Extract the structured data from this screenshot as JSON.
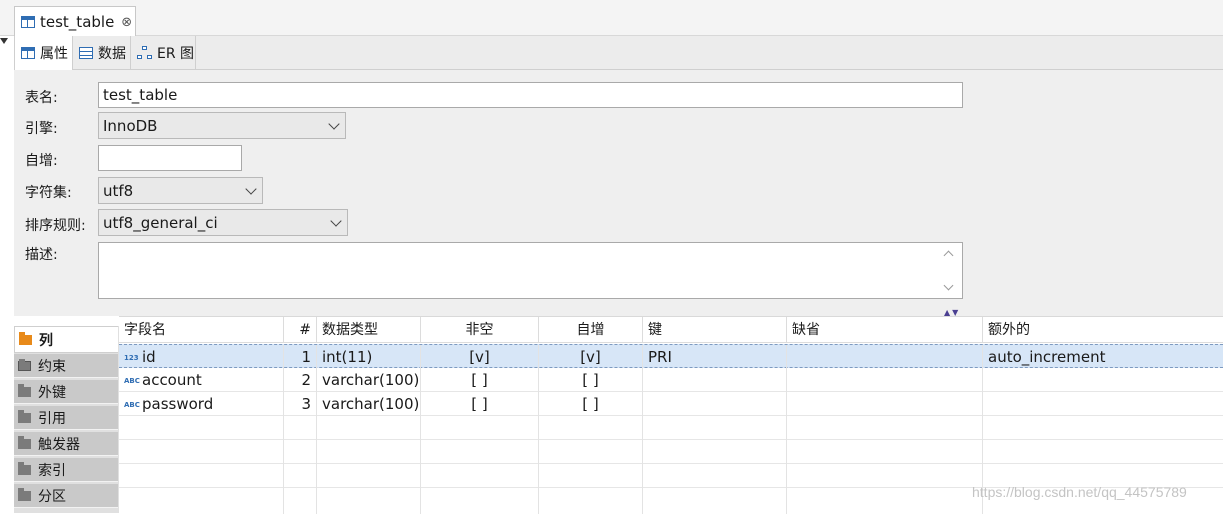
{
  "editor_tab": {
    "title": "test_table",
    "close": "⊗"
  },
  "subtabs": [
    {
      "label": "属性",
      "icon": "table-icon"
    },
    {
      "label": "数据",
      "icon": "data-grid-icon"
    },
    {
      "label": "ER 图",
      "icon": "er-diagram-icon"
    }
  ],
  "form": {
    "table_name_label": "表名:",
    "table_name_value": "test_table",
    "engine_label": "引擎:",
    "engine_value": "InnoDB",
    "auto_inc_label": "自增:",
    "auto_inc_value": "",
    "charset_label": "字符集:",
    "charset_value": "utf8",
    "collation_label": "排序规则:",
    "collation_value": "utf8_general_ci",
    "comment_label": "描述:",
    "comment_value": ""
  },
  "side_tabs": [
    "列",
    "约束",
    "外键",
    "引用",
    "触发器",
    "索引",
    "分区"
  ],
  "columns_table": {
    "headers": [
      "字段名",
      "#",
      "数据类型",
      "非空",
      "自增",
      "键",
      "缺省",
      "额外的"
    ],
    "rows": [
      {
        "type_icon": "123",
        "name": "id",
        "num": "1",
        "datatype": "int(11)",
        "not_null": "[v]",
        "auto_inc": "[v]",
        "key": "PRI",
        "default": "",
        "extra": "auto_increment"
      },
      {
        "type_icon": "ABC",
        "name": "account",
        "num": "2",
        "datatype": "varchar(100)",
        "not_null": "[ ]",
        "auto_inc": "[ ]",
        "key": "",
        "default": "",
        "extra": ""
      },
      {
        "type_icon": "ABC",
        "name": "password",
        "num": "3",
        "datatype": "varchar(100)",
        "not_null": "[ ]",
        "auto_inc": "[ ]",
        "key": "",
        "default": "",
        "extra": ""
      }
    ]
  },
  "watermark": "https://blog.csdn.net/qq_44575789"
}
